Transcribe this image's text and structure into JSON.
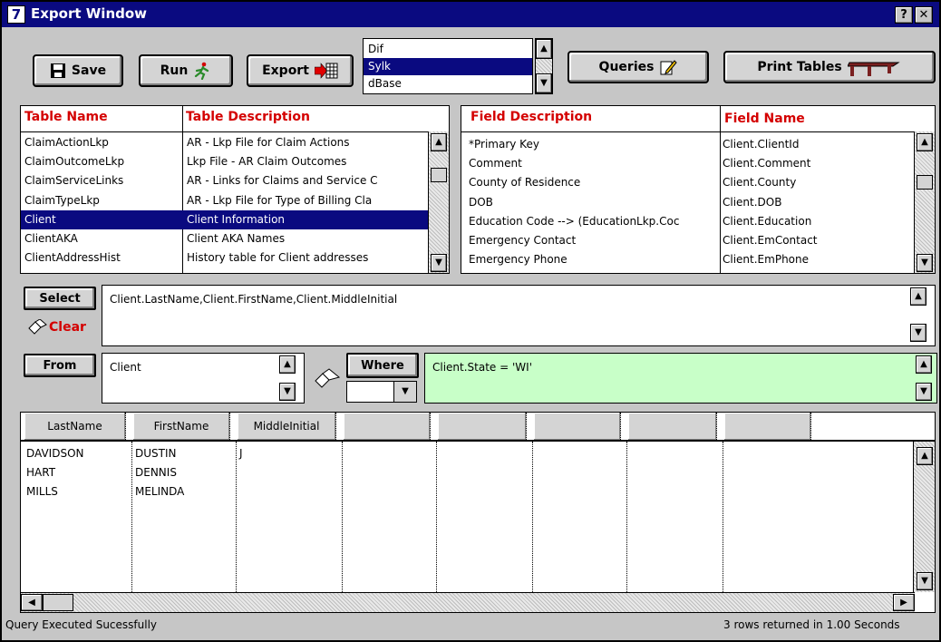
{
  "window": {
    "title": "Export Window",
    "app_icon": "7",
    "help_label": "?",
    "close_label": "✕"
  },
  "toolbar": {
    "save_label": "Save",
    "run_label": "Run",
    "export_label": "Export",
    "queries_label": "Queries",
    "print_tables_label": "Print Tables",
    "formats": [
      "Dif",
      "Sylk",
      "dBase"
    ],
    "selected_format": "Sylk"
  },
  "tables": {
    "name_header": "Table Name",
    "description_header": "Table Description",
    "rows": [
      {
        "name": "ClaimActionLkp",
        "description": "AR - Lkp File for Claim Actions"
      },
      {
        "name": "ClaimOutcomeLkp",
        "description": "Lkp File - AR Claim Outcomes"
      },
      {
        "name": "ClaimServiceLinks",
        "description": "AR - Links for Claims and Service C"
      },
      {
        "name": "ClaimTypeLkp",
        "description": "AR - Lkp File for Type of Billing Cla"
      },
      {
        "name": "Client",
        "description": "Client Information"
      },
      {
        "name": "ClientAKA",
        "description": "Client AKA Names"
      },
      {
        "name": "ClientAddressHist",
        "description": "History table for Client addresses"
      }
    ],
    "selected_row": "Client"
  },
  "fields": {
    "description_header": "Field Description",
    "name_header": "Field Name",
    "rows": [
      {
        "description": "*Primary Key",
        "name": "Client.ClientId"
      },
      {
        "description": "Comment",
        "name": "Client.Comment"
      },
      {
        "description": "County of Residence",
        "name": "Client.County"
      },
      {
        "description": "DOB",
        "name": "Client.DOB"
      },
      {
        "description": "Education Code --> (EducationLkp.Coc",
        "name": "Client.Education"
      },
      {
        "description": "Emergency Contact",
        "name": "Client.EmContact"
      },
      {
        "description": "Emergency Phone",
        "name": "Client.EmPhone"
      }
    ]
  },
  "query": {
    "select_label": "Select",
    "clear_label": "Clear",
    "select_value": "Client.LastName,Client.FirstName,Client.MiddleInitial",
    "from_label": "From",
    "from_value": "Client",
    "where_label": "Where",
    "where_value": "Client.State = 'WI'"
  },
  "results": {
    "columns": [
      "LastName",
      "FirstName",
      "MiddleInitial",
      "",
      "",
      "",
      "",
      ""
    ],
    "rows": [
      [
        "DAVIDSON",
        "DUSTIN",
        "J"
      ],
      [
        "HART",
        "DENNIS",
        ""
      ],
      [
        "MILLS",
        "MELINDA",
        ""
      ]
    ]
  },
  "status": {
    "left": "Query Executed Sucessfully",
    "right": "3 rows returned in 1.00 Seconds"
  },
  "colors": {
    "title_bar": "#0a0a80",
    "header_red": "#d40000",
    "where_bg": "#c8ffc8",
    "selection": "#0a0a80"
  }
}
